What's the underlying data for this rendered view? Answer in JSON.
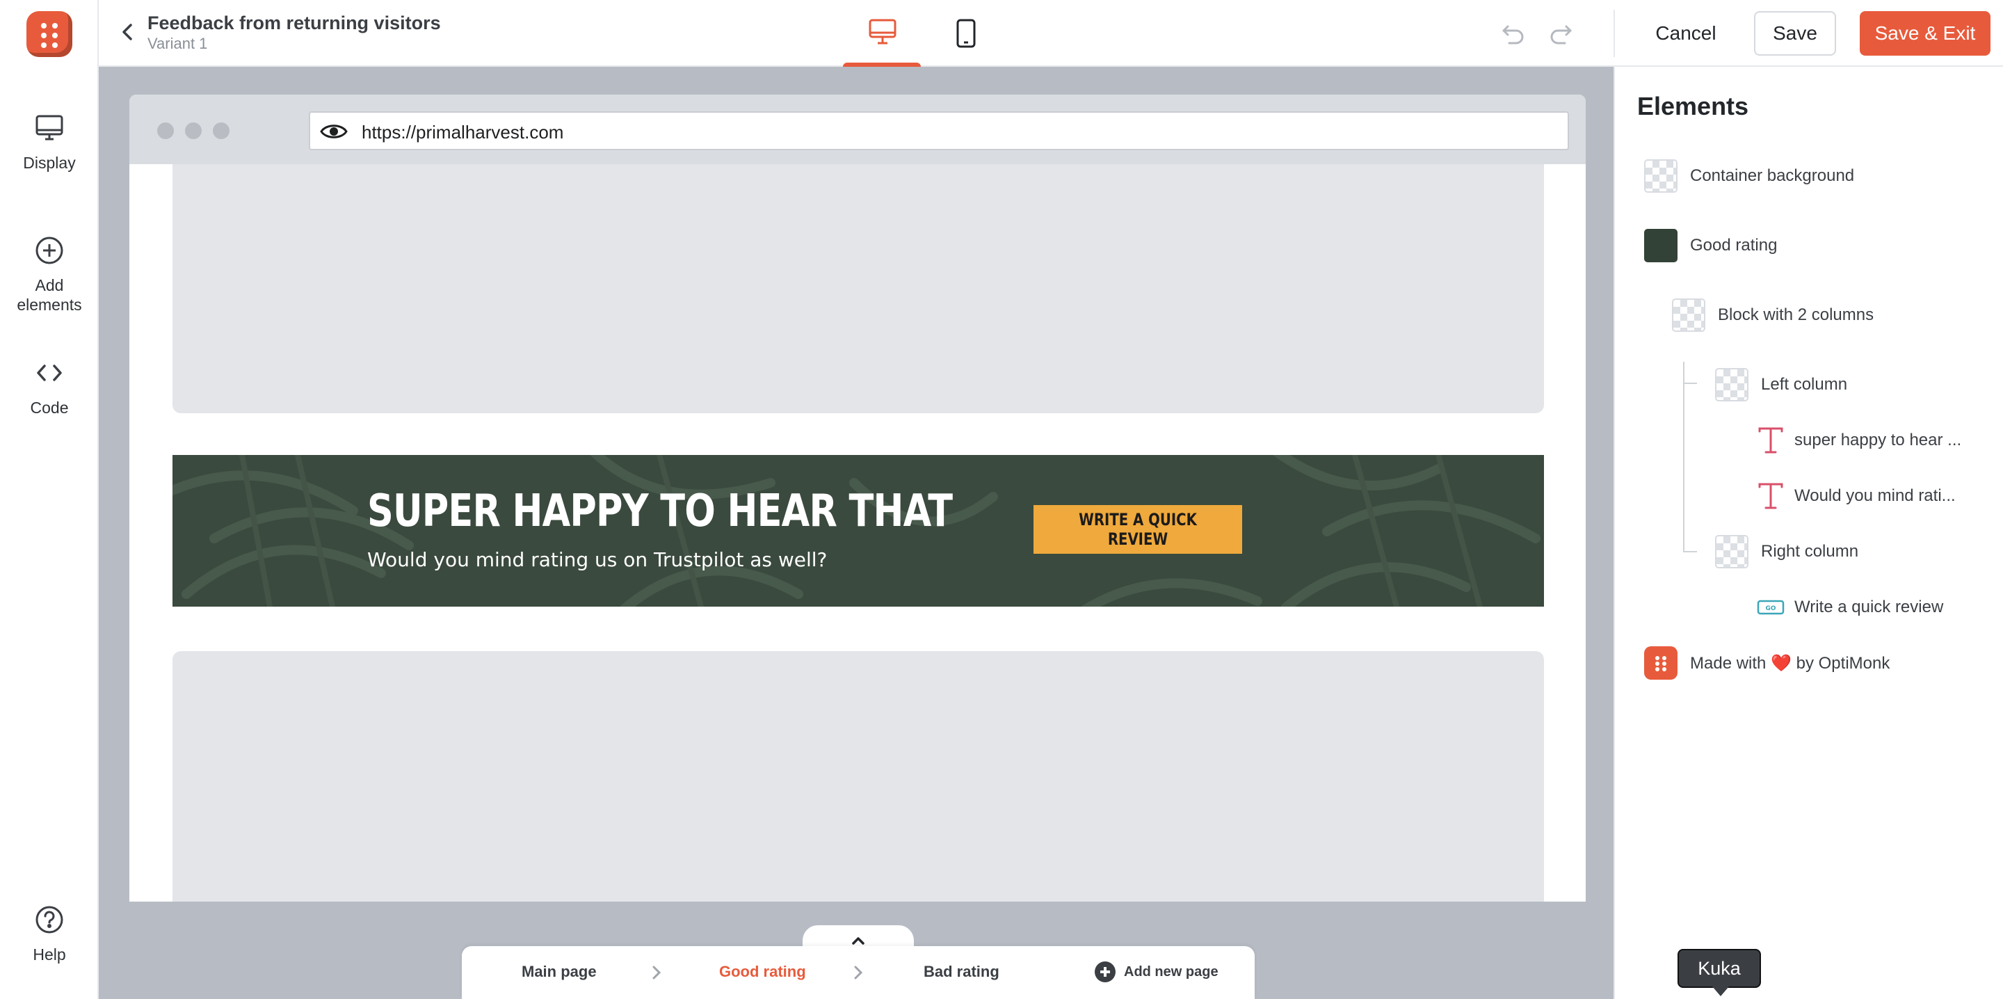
{
  "app": {
    "title": "Feedback from returning visitors",
    "variant": "Variant 1",
    "accent_color": "#e75b3c"
  },
  "left_rail": {
    "items": [
      {
        "label": "Display",
        "icon": "monitor-icon"
      },
      {
        "label": "Add elements",
        "icon": "plus-circle-icon"
      },
      {
        "label": "Code",
        "icon": "code-icon"
      },
      {
        "label": "Help",
        "icon": "help-icon"
      }
    ]
  },
  "toolbar": {
    "cancel_label": "Cancel",
    "save_label": "Save",
    "save_exit_label": "Save & Exit",
    "active_device": "desktop"
  },
  "browser": {
    "url": "https://primalharvest.com"
  },
  "popup": {
    "headline": "SUPER HAPPY TO HEAR THAT",
    "subtext": "Would you mind rating us on Trustpilot as well?",
    "cta_label": "WRITE A QUICK REVIEW",
    "background_color": "#3a4a3e",
    "cta_color": "#efa93c"
  },
  "pages": {
    "tabs": [
      {
        "label": "Main page",
        "active": false
      },
      {
        "label": "Good rating",
        "active": true
      },
      {
        "label": "Bad rating",
        "active": false
      }
    ],
    "add_label": "Add new page"
  },
  "elements_panel": {
    "title": "Elements",
    "items": [
      {
        "label": "Container background",
        "icon": "checker-thumb"
      },
      {
        "label": "Good rating",
        "icon": "green-thumb"
      },
      {
        "label": "Block with 2 columns",
        "icon": "checker-thumb"
      },
      {
        "label": "Left column",
        "icon": "checker-thumb"
      },
      {
        "label": "super happy to hear ...",
        "icon": "text-icon"
      },
      {
        "label": "Would you mind rati...",
        "icon": "text-icon"
      },
      {
        "label": "Right column",
        "icon": "checker-thumb"
      },
      {
        "label": "Write a quick review",
        "icon": "button-icon"
      }
    ],
    "footer_prefix": "Made with",
    "footer_suffix": "by OptiMonk"
  },
  "tooltip": {
    "text": "Kuka"
  }
}
